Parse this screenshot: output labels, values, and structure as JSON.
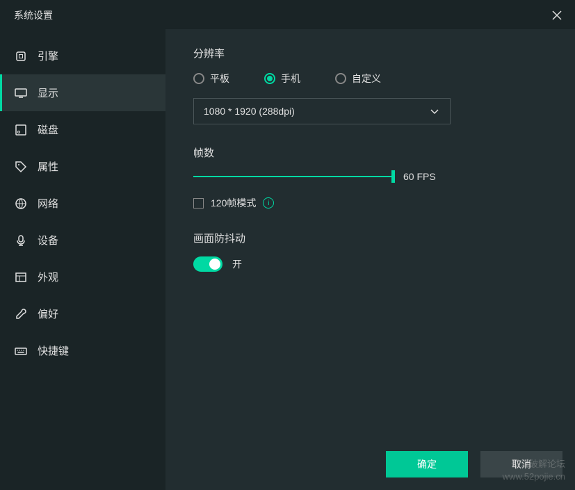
{
  "window": {
    "title": "系统设置"
  },
  "sidebar": {
    "items": [
      {
        "label": "引擎",
        "icon": "chip"
      },
      {
        "label": "显示",
        "icon": "monitor"
      },
      {
        "label": "磁盘",
        "icon": "disk"
      },
      {
        "label": "属性",
        "icon": "tag"
      },
      {
        "label": "网络",
        "icon": "globe"
      },
      {
        "label": "设备",
        "icon": "mic"
      },
      {
        "label": "外观",
        "icon": "layout"
      },
      {
        "label": "偏好",
        "icon": "wrench"
      },
      {
        "label": "快捷键",
        "icon": "keyboard"
      }
    ],
    "active_index": 1
  },
  "resolution": {
    "label": "分辨率",
    "options": {
      "tablet": "平板",
      "phone": "手机",
      "custom": "自定义"
    },
    "selected": "phone",
    "dropdown_value": "1080 * 1920 (288dpi)"
  },
  "fps": {
    "label": "帧数",
    "value_label": "60 FPS",
    "checkbox_label": "120帧模式"
  },
  "antishake": {
    "label": "画面防抖动",
    "toggle_label": "开",
    "enabled": true
  },
  "buttons": {
    "ok": "确定",
    "cancel": "取消"
  },
  "watermark": {
    "line1": "吾爱破解论坛",
    "line2": "www.52pojie.cn"
  }
}
